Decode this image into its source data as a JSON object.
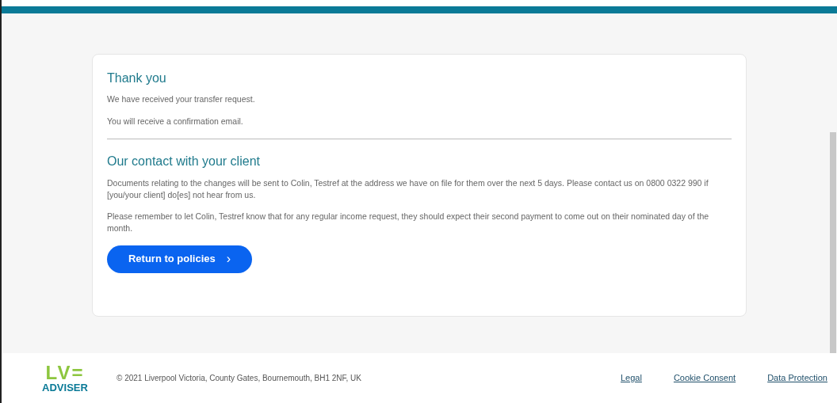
{
  "card": {
    "title": "Thank you",
    "messages": [
      "We have received your transfer request.",
      "You will receive a confirmation email."
    ],
    "contact_heading": "Our contact with your client",
    "paragraphs": [
      "Documents relating to the changes will be sent to Colin, Testref at the address we have on file for them over the next 5 days. Please contact us on 0800 0322 990 if [you/your client] do[es] not hear from us.",
      "Please remember to let Colin, Testref know that for any regular income request, they should expect their second payment to come out on their nominated day of the month."
    ],
    "button": {
      "label": "Return to policies",
      "icon": "›"
    }
  },
  "footer": {
    "logo": {
      "mark": "LV=",
      "word": "ADVISER"
    },
    "copyright": "© 2021 Liverpool Victoria, County Gates, Bournemouth, BH1 2NF, UK",
    "links": [
      "Legal",
      "Cookie Consent",
      "Data Protection"
    ]
  }
}
